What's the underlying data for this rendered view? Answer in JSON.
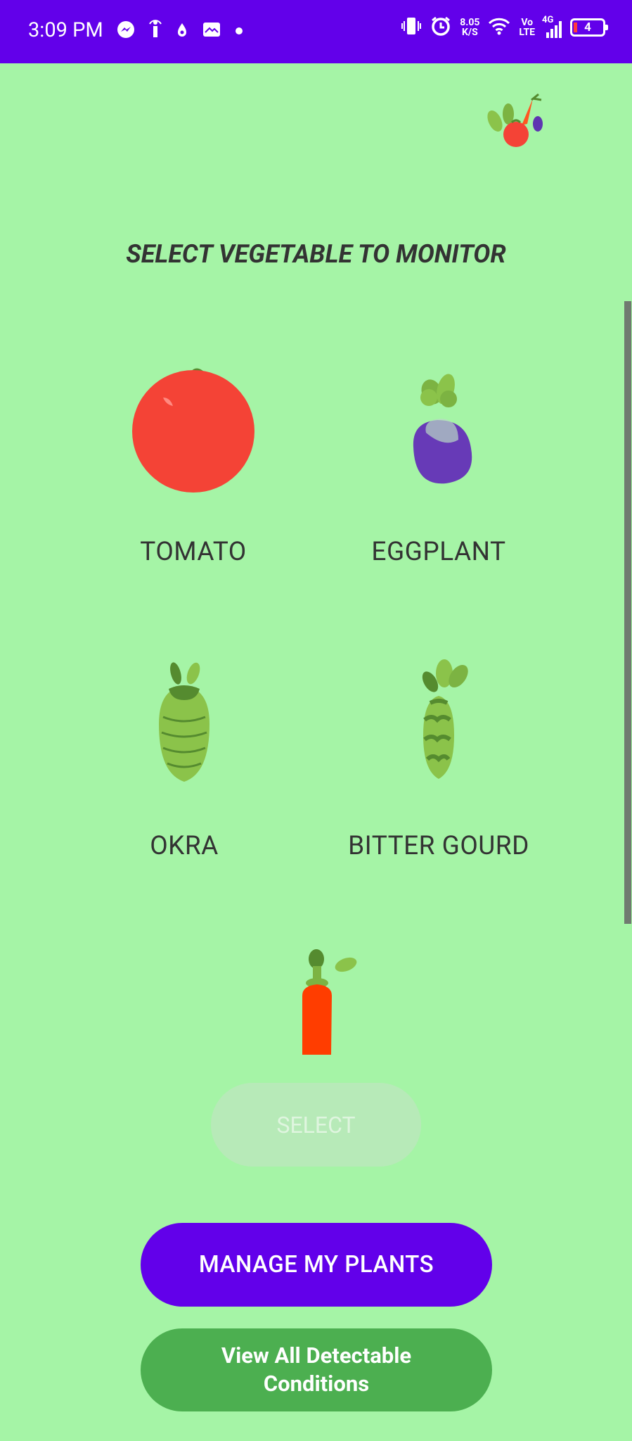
{
  "status_bar": {
    "time": "3:09 PM",
    "net_speed": "8.05",
    "net_unit": "K/S",
    "volte_top": "Vo",
    "volte_bottom": "LTE",
    "network": "4G",
    "battery": "4"
  },
  "page_title": "SELECT VEGETABLE TO MONITOR",
  "vegetables": [
    {
      "label": "TOMATO"
    },
    {
      "label": "EGGPLANT"
    },
    {
      "label": "OKRA"
    },
    {
      "label": "BITTER GOURD"
    }
  ],
  "buttons": {
    "select": "SELECT",
    "manage": "MANAGE MY PLANTS",
    "view_line1": "View All Detectable",
    "view_line2": "Conditions"
  },
  "colors": {
    "background": "#a5f4a6",
    "status_bar": "#6200ea",
    "primary_button": "#6200ea",
    "secondary_button": "#4caf50"
  }
}
